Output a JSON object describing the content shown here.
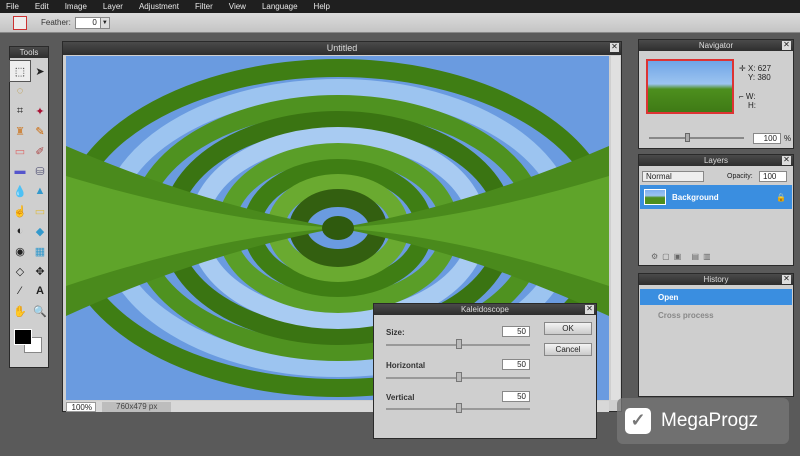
{
  "menu": [
    "File",
    "Edit",
    "Image",
    "Layer",
    "Adjustment",
    "Filter",
    "View",
    "Language",
    "Help"
  ],
  "options": {
    "feather_label": "Feather:",
    "feather_value": "0"
  },
  "tools_panel": {
    "title": "Tools"
  },
  "canvas_window": {
    "title": "Untitled",
    "zoom": "100%",
    "dimensions": "760x479 px"
  },
  "navigator": {
    "title": "Navigator",
    "x_label": "X:",
    "x_value": "627",
    "y_label": "Y:",
    "y_value": "380",
    "w_label": "W:",
    "h_label": "H:",
    "zoom": "100",
    "zoom_unit": "%"
  },
  "layers": {
    "title": "Layers",
    "blend_mode": "Normal",
    "opacity_label": "Opacity:",
    "opacity_value": "100",
    "layer_name": "Background"
  },
  "history": {
    "title": "History",
    "items": [
      "Open",
      "Cross process"
    ]
  },
  "kaleidoscope": {
    "title": "Kaleidoscope",
    "size_label": "Size:",
    "size_value": "50",
    "horizontal_label": "Horizontal",
    "horizontal_value": "50",
    "vertical_label": "Vertical",
    "vertical_value": "50",
    "ok_label": "OK",
    "cancel_label": "Cancel"
  },
  "watermark": {
    "text": "MegaProgz"
  },
  "colors": {
    "accent": "#3a8ee0",
    "panel_bg": "#cfcfcf",
    "title_bg": "#2e2e2e",
    "grass": "#4d8f1e",
    "sky": "#7aa7e6"
  }
}
